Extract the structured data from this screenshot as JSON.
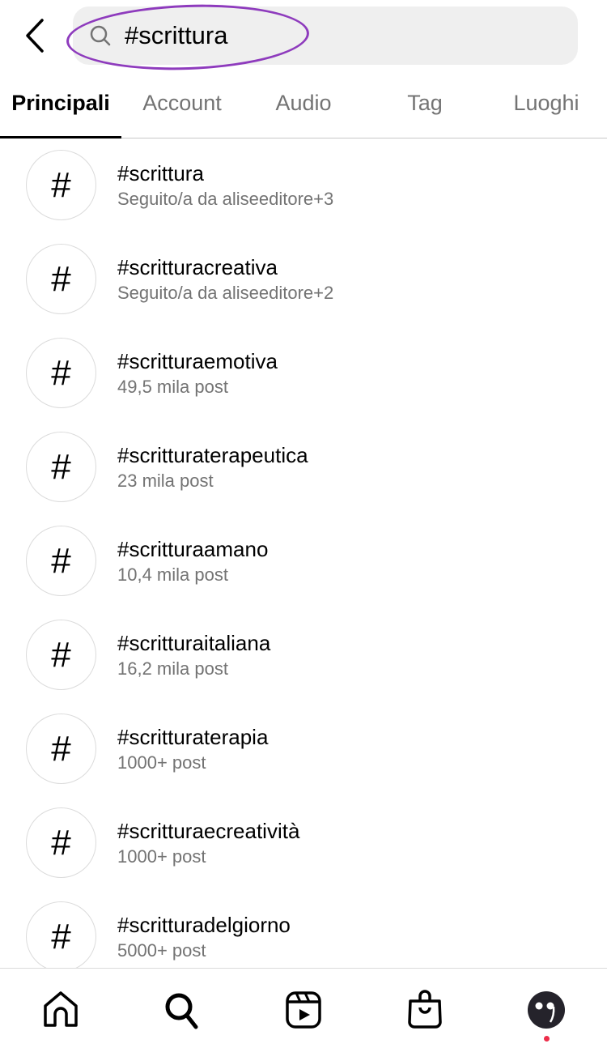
{
  "search": {
    "query": "#scrittura"
  },
  "tabs": [
    {
      "label": "Principali"
    },
    {
      "label": "Account"
    },
    {
      "label": "Audio"
    },
    {
      "label": "Tag"
    },
    {
      "label": "Luoghi"
    }
  ],
  "results": [
    {
      "title": "#scrittura",
      "subtitle": "Seguito/a da aliseeditore+3"
    },
    {
      "title": "#scritturacreativa",
      "subtitle": "Seguito/a da aliseeditore+2"
    },
    {
      "title": "#scritturaemotiva",
      "subtitle": "49,5 mila post"
    },
    {
      "title": "#scritturaterapeutica",
      "subtitle": "23 mila post"
    },
    {
      "title": "#scritturaamano",
      "subtitle": "10,4 mila post"
    },
    {
      "title": "#scritturaitaliana",
      "subtitle": "16,2 mila post"
    },
    {
      "title": "#scritturaterapia",
      "subtitle": "1000+ post"
    },
    {
      "title": "#scritturaecreatività",
      "subtitle": "1000+ post"
    },
    {
      "title": "#scritturadelgiorno",
      "subtitle": "5000+ post"
    }
  ],
  "hash_symbol": "#",
  "colors": {
    "highlight": "#8e3bbd",
    "notification": "#ed2e4a"
  }
}
